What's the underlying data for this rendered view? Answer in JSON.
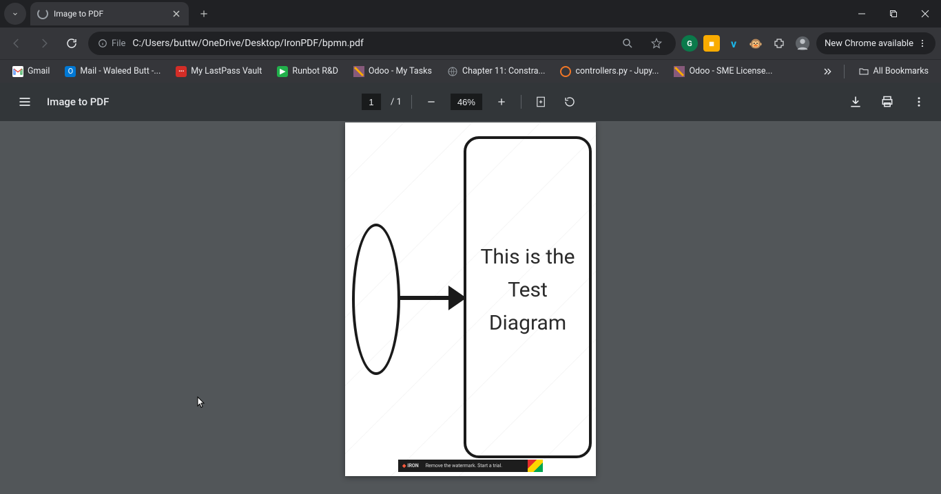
{
  "browser": {
    "tab_title": "Image to PDF",
    "url_scheme_label": "File",
    "url_path": "C:/Users/buttw/OneDrive/Desktop/IronPDF/bpmn.pdf",
    "profile_chip_label": "New Chrome available"
  },
  "bookmarks": {
    "items": [
      {
        "label": "Gmail"
      },
      {
        "label": "Mail - Waleed Butt -..."
      },
      {
        "label": "My LastPass Vault"
      },
      {
        "label": "Runbot R&D"
      },
      {
        "label": "Odoo - My Tasks"
      },
      {
        "label": "Chapter 11: Constra..."
      },
      {
        "label": "controllers.py - Jupy..."
      },
      {
        "label": "Odoo - SME License..."
      }
    ],
    "all_label": "All Bookmarks"
  },
  "pdf": {
    "title": "Image to PDF",
    "current_page": "1",
    "total_pages": "1",
    "zoom_level": "46%"
  },
  "diagram": {
    "task_text": "This is the Test Diagram"
  },
  "trial": {
    "brand": "IRON",
    "message": "Remove the watermark. Start a trial."
  }
}
